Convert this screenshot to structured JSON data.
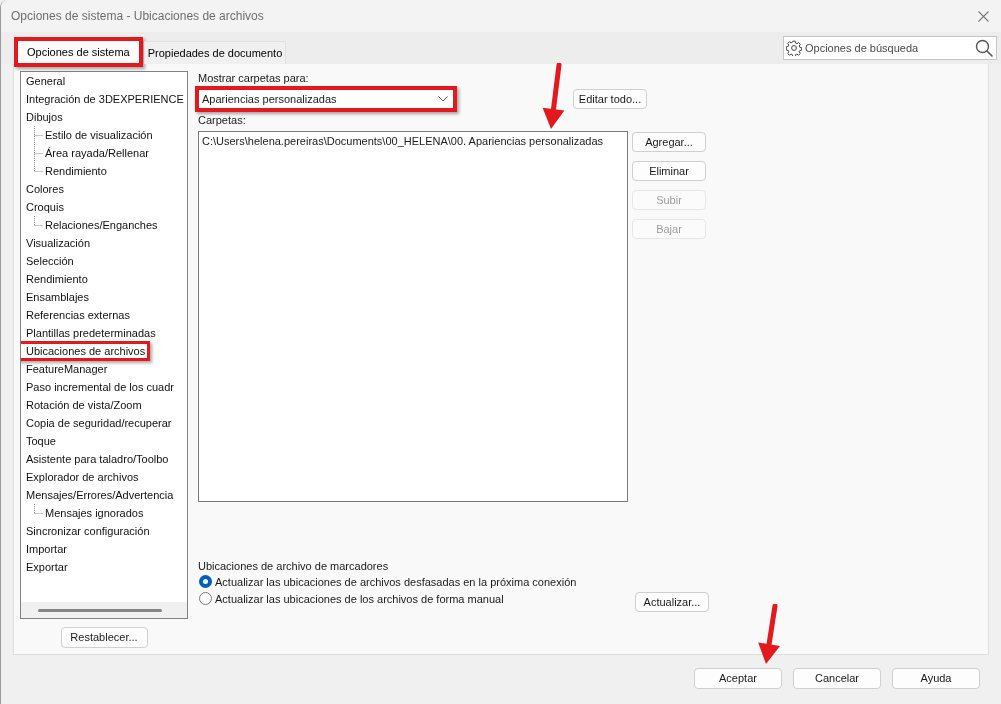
{
  "window": {
    "title": "Opciones de sistema - Ubicaciones de archivos"
  },
  "tabs": [
    {
      "label": "Opciones de sistema",
      "selected": true,
      "annotated": true
    },
    {
      "label": "Propiedades de documento",
      "selected": false,
      "annotated": false
    }
  ],
  "search": {
    "placeholder": "Opciones de búsqueda"
  },
  "sidebar": {
    "items": [
      {
        "label": "General",
        "annotated": false
      },
      {
        "label": "Integración de 3DEXPERIENCE",
        "annotated": false
      },
      {
        "label": "Dibujos",
        "annotated": false,
        "children": [
          {
            "label": "Estilo de visualización",
            "annotated": false
          },
          {
            "label": "Área rayada/Rellenar",
            "annotated": false
          },
          {
            "label": "Rendimiento",
            "annotated": false
          }
        ]
      },
      {
        "label": "Colores",
        "annotated": false
      },
      {
        "label": "Croquis",
        "annotated": false,
        "children": [
          {
            "label": "Relaciones/Enganches",
            "annotated": false
          }
        ]
      },
      {
        "label": "Visualización",
        "annotated": false
      },
      {
        "label": "Selección",
        "annotated": false
      },
      {
        "label": "Rendimiento",
        "annotated": false
      },
      {
        "label": "Ensamblajes",
        "annotated": false
      },
      {
        "label": "Referencias externas",
        "annotated": false
      },
      {
        "label": "Plantillas predeterminadas",
        "annotated": false
      },
      {
        "label": "Ubicaciones de archivos",
        "annotated": true
      },
      {
        "label": "FeatureManager",
        "annotated": false
      },
      {
        "label": "Paso incremental de los cuadr",
        "annotated": false
      },
      {
        "label": "Rotación de vista/Zoom",
        "annotated": false
      },
      {
        "label": "Copia de seguridad/recuperar",
        "annotated": false
      },
      {
        "label": "Toque",
        "annotated": false
      },
      {
        "label": "Asistente para taladro/Toolbo",
        "annotated": false
      },
      {
        "label": "Explorador de archivos",
        "annotated": false
      },
      {
        "label": "Mensajes/Errores/Advertencia",
        "annotated": false,
        "children": [
          {
            "label": "Mensajes ignorados",
            "annotated": false
          }
        ]
      },
      {
        "label": "Sincronizar configuración",
        "annotated": false
      },
      {
        "label": "Importar",
        "annotated": false
      },
      {
        "label": "Exportar",
        "annotated": false
      }
    ],
    "reset_button": "Restablecer..."
  },
  "folders": {
    "show_label": "Mostrar carpetas para:",
    "dropdown": {
      "value": "Apariencias personalizadas",
      "annotated": true
    },
    "edit_all_button": "Editar todo...",
    "list_label": "Carpetas:",
    "entries": [
      {
        "path": "C:\\Users\\helena.pereiras\\Documents\\00_HELENA\\00. Apariencias personalizadas",
        "arrow": true
      }
    ],
    "buttons": [
      {
        "label": "Agregar...",
        "disabled": false
      },
      {
        "label": "Eliminar",
        "disabled": false
      },
      {
        "label": "Subir",
        "disabled": true
      },
      {
        "label": "Bajar",
        "disabled": true
      }
    ]
  },
  "bookmarks": {
    "title": "Ubicaciones de archivo de marcadores",
    "options": [
      {
        "label": "Actualizar las ubicaciones de archivos desfasadas en la próxima conexión",
        "selected": true
      },
      {
        "label": "Actualizar las ubicaciones de los archivos de forma manual",
        "selected": false
      }
    ],
    "update_button": "Actualizar..."
  },
  "footer_buttons": [
    {
      "label": "Aceptar",
      "arrow": true
    },
    {
      "label": "Cancelar",
      "arrow": false
    },
    {
      "label": "Ayuda",
      "arrow": false
    }
  ]
}
